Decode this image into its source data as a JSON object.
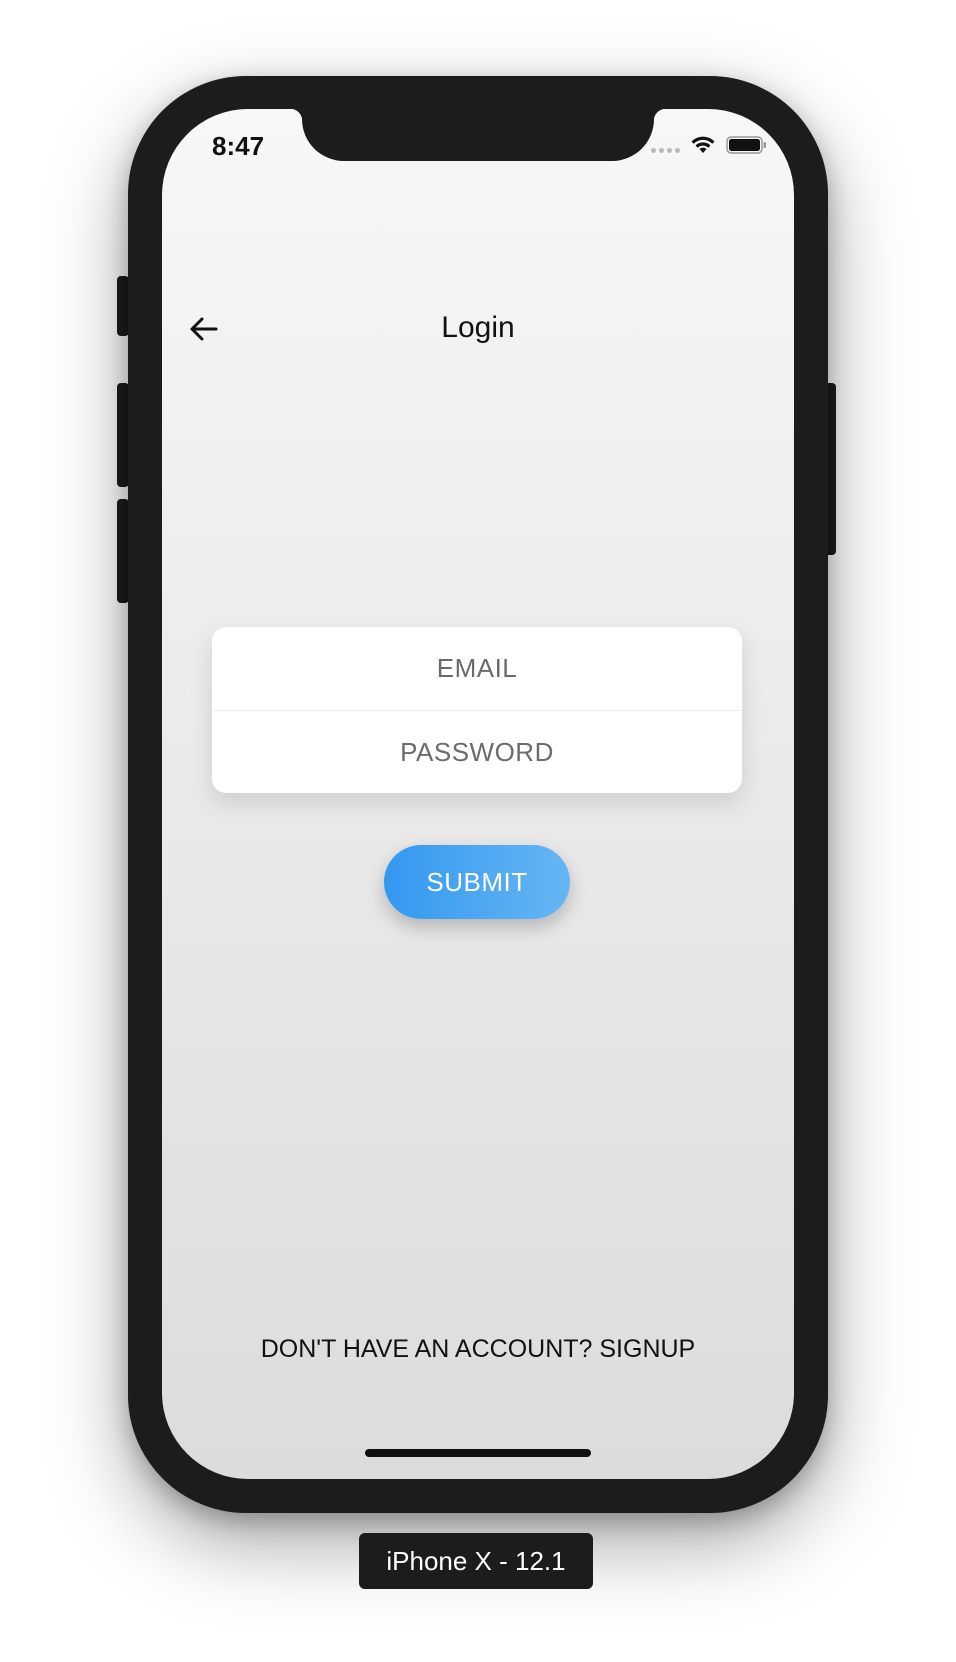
{
  "status_bar": {
    "time": "8:47",
    "wifi_icon": "wifi-icon",
    "battery_icon": "battery-icon"
  },
  "nav": {
    "back_icon": "arrow-left-icon",
    "title": "Login"
  },
  "form": {
    "email_placeholder": "EMAIL",
    "password_placeholder": "PASSWORD",
    "submit_label": "SUBMIT"
  },
  "footer": {
    "signup_text": "DON'T HAVE AN ACCOUNT? SIGNUP"
  },
  "simulator": {
    "device_label": "iPhone X - 12.1"
  },
  "colors": {
    "accent_start": "#3498f0",
    "accent_end": "#66b6f4",
    "device_frame": "#1c1c1c"
  }
}
